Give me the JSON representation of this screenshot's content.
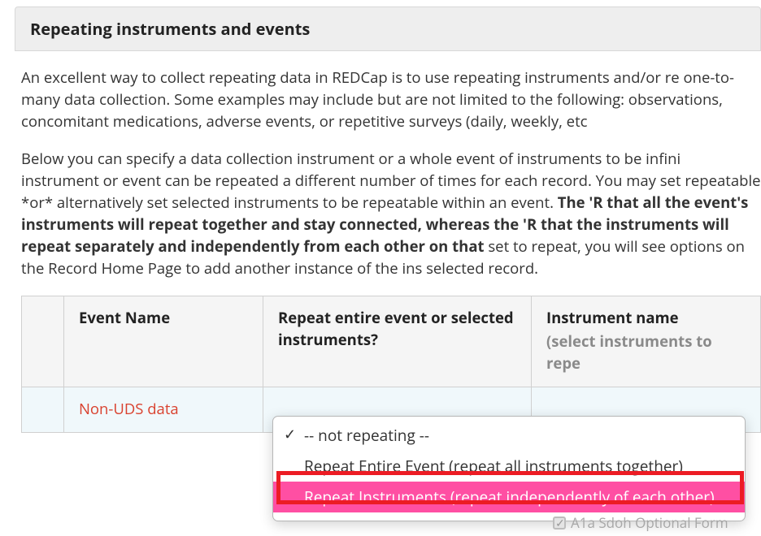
{
  "panel": {
    "title": "Repeating instruments and events",
    "para1": "An excellent way to collect repeating data in REDCap is to use repeating instruments and/or re one-to-many data collection. Some examples may include but are not limited to the following: observations, concomitant medications, adverse events, or repetitive surveys (daily, weekly, etc",
    "para2a": "Below you can specify a data collection instrument or a whole event of instruments to be infini instrument or event can be repeated a different number of times for each record. You may set repeatable *or* alternatively set selected instruments to be repeatable within an event. ",
    "para2b": "The 'R that all the event's instruments will repeat together and stay connected, whereas the 'R that the instruments will repeat separately and independently from each other on that ",
    "para2c": " set to repeat, you will see options on the Record Home Page to add another instance of the ins selected record."
  },
  "table": {
    "headers": {
      "event": "Event Name",
      "repeat": "Repeat entire event or selected instruments?",
      "instr": "Instrument name",
      "instr_sub": "(select instruments to repe"
    },
    "row": {
      "event": "Non-UDS data"
    }
  },
  "dropdown": {
    "opt_not": "-- not repeating --",
    "opt_entire": "Repeat Entire Event (repeat all instruments together)",
    "opt_instr": "Repeat Instruments (repeat independently of each other)"
  },
  "ghost": {
    "label": "A1a Sdoh Optional Form"
  }
}
